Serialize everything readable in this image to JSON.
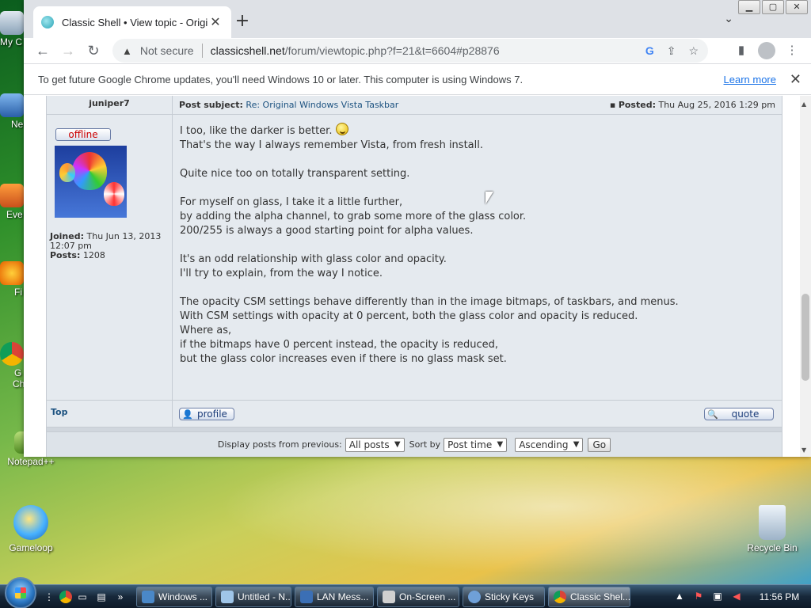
{
  "desktop": {
    "left_icons": [
      {
        "label": "My C",
        "icon": "computer-icon"
      },
      {
        "label": "Ne",
        "icon": "network-icon"
      },
      {
        "label": "Eve",
        "icon": "app-icon"
      },
      {
        "label": "Fi",
        "icon": "firefox-icon"
      },
      {
        "label": "G",
        "icon": "chrome-icon"
      },
      {
        "label": "Ch",
        "icon": "chrome-icon"
      }
    ],
    "notepad_label": "Notepad++",
    "gameloop_label": "Gameloop",
    "recycle_label": "Recycle Bin"
  },
  "browser": {
    "tab_title": "Classic Shell • View topic - Origin",
    "new_tab": "+",
    "tab_search": "⌄",
    "not_secure": "Not secure",
    "url_domain": "classicshell.net",
    "url_path": "/forum/viewtopic.php?f=21&t=6604#p28876",
    "google_icon": "G",
    "infobar_text": "To get future Google Chrome updates, you'll need Windows 10 or later. This computer is using Windows 7.",
    "infobar_link": "Learn more"
  },
  "post": {
    "author": "juniper7",
    "subject_label": "Post subject:",
    "subject": "Re: Original Windows Vista Taskbar",
    "posted_label": "Posted:",
    "posted_date": "Thu Aug 25, 2016 1:29 pm",
    "status": "offline",
    "joined_label": "Joined:",
    "joined_value": "Thu Jun 13, 2013 12:07 pm",
    "posts_label": "Posts:",
    "posts_value": "1208",
    "paragraphs": [
      {
        "lines": [
          "I too, like the darker is better.",
          "That's the way I always remember Vista, from fresh install."
        ]
      },
      {
        "lines": [
          "Quite nice too on totally transparent setting."
        ]
      },
      {
        "lines": [
          "For myself on glass, I take it a little further,",
          "by adding the alpha channel, to grab some more of the glass color.",
          "200/255 is always a good starting point for alpha values."
        ]
      },
      {
        "lines": [
          "It's an odd relationship with glass color and opacity.",
          "I'll try to explain, from the way I notice."
        ]
      },
      {
        "lines": [
          "The opacity CSM settings behave differently than in the image bitmaps, of taskbars, and menus.",
          "With CSM settings with opacity at 0 percent, both the glass color and opacity is reduced.",
          "Where as,",
          "if the bitmaps have 0 percent instead, the opacity is reduced,",
          "but the glass color increases even if there is no glass mask set."
        ]
      }
    ],
    "top_link": "Top",
    "profile_button": "profile",
    "quote_button": "quote"
  },
  "filter": {
    "display_label": "Display posts from previous:",
    "display_value": "All posts",
    "sort_label": "Sort by",
    "sort_value": "Post time",
    "order_value": "Ascending",
    "go_label": "Go"
  },
  "taskbar": {
    "tasks": [
      {
        "label": "Windows ...",
        "color": "#4a88c8"
      },
      {
        "label": "Untitled - N...",
        "color": "#9fc5e8"
      },
      {
        "label": "LAN Mess...",
        "color": "#3b6fb5"
      },
      {
        "label": "On-Screen ...",
        "color": "#d0d0d0"
      },
      {
        "label": "Sticky Keys",
        "color": "#6fa0d8"
      },
      {
        "label": "Classic Shel...",
        "color": "#e94235"
      }
    ],
    "clock": "11:56 PM"
  },
  "colors": {
    "forum_bg": "#e5eaef",
    "link": "#1c5280",
    "offline": "#cc0000",
    "chrome_link": "#1a73e8"
  }
}
